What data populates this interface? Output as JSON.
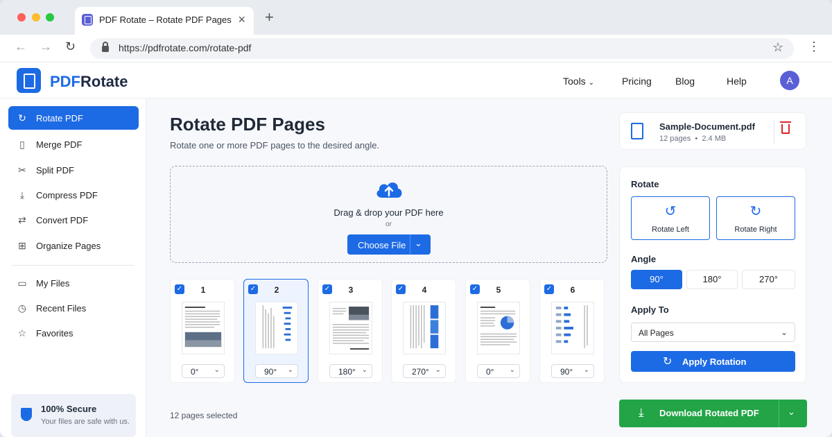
{
  "browser": {
    "tab_title": "PDF Rotate – Rotate PDF Pages",
    "url": "https://pdfrotate.com/rotate-pdf"
  },
  "header": {
    "brand_pdf": "PDF",
    "brand_rotate": "Rotate",
    "nav": {
      "tools": "Tools",
      "pricing": "Pricing",
      "blog": "Blog",
      "help": "Help"
    },
    "avatar": "A"
  },
  "sidebar": {
    "items": [
      {
        "label": "Rotate PDF",
        "icon": "rotate-icon"
      },
      {
        "label": "Merge PDF",
        "icon": "document-icon"
      },
      {
        "label": "Split PDF",
        "icon": "scissors-icon"
      },
      {
        "label": "Compress PDF",
        "icon": "compress-icon"
      },
      {
        "label": "Convert PDF",
        "icon": "convert-icon"
      },
      {
        "label": "Organize Pages",
        "icon": "grid-icon"
      }
    ],
    "files": [
      {
        "label": "My Files",
        "icon": "folder-icon"
      },
      {
        "label": "Recent Files",
        "icon": "clock-icon"
      },
      {
        "label": "Favorites",
        "icon": "star-icon"
      }
    ],
    "secure": {
      "title": "100% Secure",
      "subtitle": "Your files are safe with us."
    }
  },
  "main": {
    "title": "Rotate PDF Pages",
    "subtitle": "Rotate one or more PDF pages to the desired angle.",
    "drop": {
      "text": "Drag & drop your PDF here",
      "or": "or",
      "button": "Choose File"
    },
    "pages": [
      {
        "num": "1",
        "angle": "0°"
      },
      {
        "num": "2",
        "angle": "90°"
      },
      {
        "num": "3",
        "angle": "180°"
      },
      {
        "num": "4",
        "angle": "270°"
      },
      {
        "num": "5",
        "angle": "0°"
      },
      {
        "num": "6",
        "angle": "90°"
      }
    ],
    "selected_count": "12 pages selected"
  },
  "file": {
    "name": "Sample-Document.pdf",
    "pages": "12 pages",
    "size": "2.4 MB"
  },
  "rotate_panel": {
    "rotate_heading": "Rotate",
    "rotate_left": "Rotate Left",
    "rotate_right": "Rotate Right",
    "angle_heading": "Angle",
    "angles": [
      "90°",
      "180°",
      "270°"
    ],
    "apply_to_heading": "Apply To",
    "apply_to_value": "All Pages",
    "apply_button": "Apply Rotation"
  },
  "download_button": "Download Rotated PDF",
  "colors": {
    "accent": "#1d6ae5",
    "download": "#22a447",
    "danger": "#dc2626"
  }
}
